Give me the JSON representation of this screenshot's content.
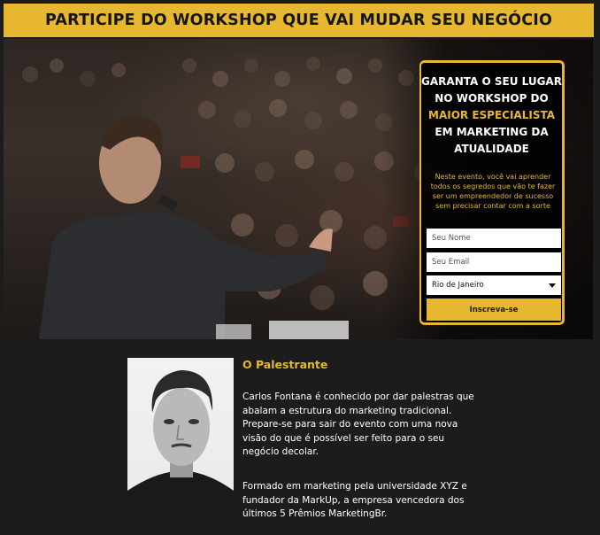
{
  "header": {
    "title": "PARTICIPE DO WORKSHOP QUE VAI MUDAR SEU NEGÓCIO"
  },
  "signup": {
    "headline_line1": "GARANTA O SEU LUGAR",
    "headline_line2": "NO WORKSHOP DO",
    "headline_highlight": "MAIOR ESPECIALISTA",
    "headline_line4": "EM MARKETING DA",
    "headline_line5": "ATUALIDADE",
    "description": "Neste evento, você vai aprender todos os segredos que vão te fazer ser um empreendedor de sucesso sem precisar contar com a sorte",
    "name_placeholder": "Seu Nome",
    "email_placeholder": "Seu Email",
    "city_selected": "Rio de Janeiro",
    "submit_label": "Inscreva-se"
  },
  "speaker": {
    "title": "O Palestrante",
    "bio_p1": "Carlos Fontana é conhecido por dar palestras que abalam a estrutura do marketing tradicional. Prepare-se para sair do evento com uma nova visão do que é possível ser feito para o seu negócio decolar.",
    "bio_p2": "Formado em marketing pela universidade XYZ e fundador da MarkUp, a empresa vencedora dos últimos 5 Prêmios MarketingBr."
  },
  "colors": {
    "accent": "#e8b730",
    "background": "#1c1c1c",
    "text": "#ffffff"
  },
  "icons": {
    "select_caret": "caret-down-icon"
  }
}
